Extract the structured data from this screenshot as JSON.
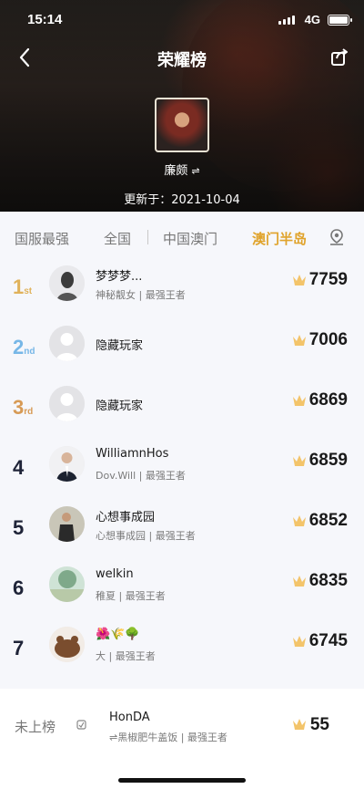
{
  "status_bar": {
    "time": "15:14",
    "network": "4G"
  },
  "header": {
    "title": "荣耀榜"
  },
  "hero": {
    "name": "廉颇",
    "swap_symbol": "⇌",
    "update_text": "更新于：2021-10-04"
  },
  "tabs": [
    {
      "label": "国服最强"
    },
    {
      "label": "全国"
    },
    {
      "label": "中国澳门"
    },
    {
      "label": "澳门半岛",
      "active": true
    }
  ],
  "rankings": [
    {
      "rank": "1",
      "suffix": "st",
      "name": "梦梦梦...",
      "sub": "神秘靓女 | 最强王者",
      "score": "7759"
    },
    {
      "rank": "2",
      "suffix": "nd",
      "name": "隐藏玩家",
      "sub": "",
      "score": "7006"
    },
    {
      "rank": "3",
      "suffix": "rd",
      "name": "隐藏玩家",
      "sub": "",
      "score": "6869"
    },
    {
      "rank": "4",
      "suffix": "",
      "name": "WilliamnHos",
      "sub": "Dov.Will | 最强王者",
      "score": "6859"
    },
    {
      "rank": "5",
      "suffix": "",
      "name": "心想事成园",
      "sub": "心想事成园 | 最强王者",
      "score": "6852"
    },
    {
      "rank": "6",
      "suffix": "",
      "name": "welkin",
      "sub": "稚夏 | 最强王者",
      "score": "6835"
    },
    {
      "rank": "7",
      "suffix": "",
      "name": "🌺🌾🌳",
      "sub": "大      | 最强王者",
      "score": "6745"
    }
  ],
  "footer": {
    "label": "未上榜",
    "name": "HonDA",
    "sub": "⇌黑椒肥牛盖饭 | 最强王者",
    "score": "55"
  },
  "colors": {
    "accent": "#e0a32b",
    "gold": "#e0b25a",
    "silver_blue": "#77b7e7",
    "bronze": "#d79a55"
  },
  "icons": {
    "back": "chevron-left-icon",
    "share": "share-icon",
    "poi": "location-icon",
    "score": "crown-icon"
  }
}
